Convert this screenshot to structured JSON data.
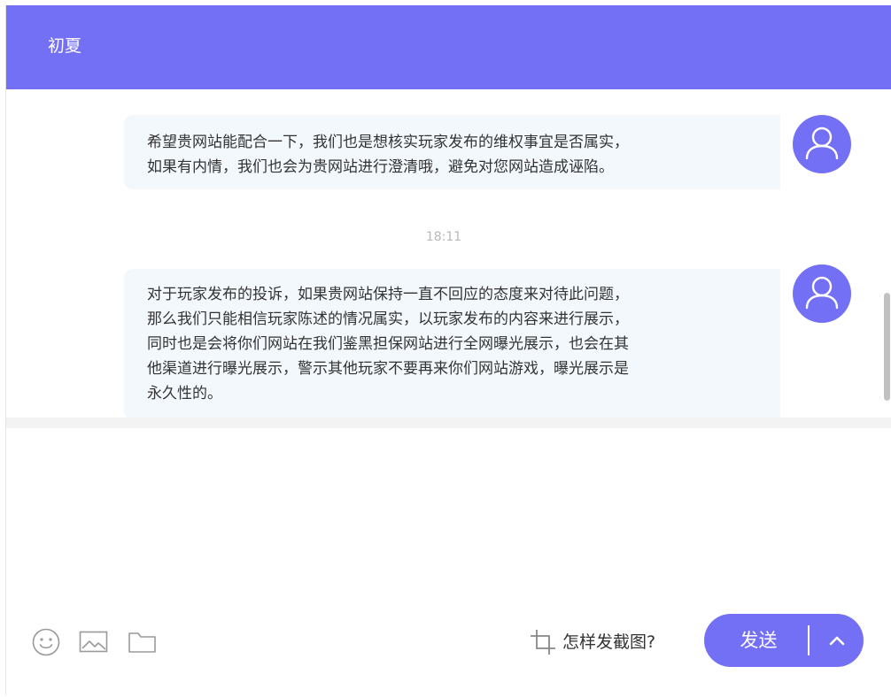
{
  "header": {
    "title": "初夏"
  },
  "messages": [
    {
      "lines": [
        "希望贵网站能配合一下，我们也是想核实玩家发布的维权事宜是否属实，",
        "如果有内情，我们也会为贵网站进行澄清哦，避免对您网站造成诬陷。"
      ],
      "avatar_icon": "user-icon"
    },
    {
      "timestamp": "18:11",
      "lines": [
        "对于玩家发布的投诉，如果贵网站保持一直不回应的态度来对待此问题，",
        "那么我们只能相信玩家陈述的情况属实，以玩家发布的内容来进行展示，",
        "同时也是会将你们网站在我们鉴黑担保网站进行全网曝光展示，也会在其",
        "他渠道进行曝光展示，警示其他玩家不要再来你们网站游戏，曝光展示是",
        "永久性的。"
      ],
      "avatar_icon": "user-icon"
    }
  ],
  "toolbar": {
    "icons": [
      "emoji-icon",
      "image-icon",
      "folder-icon"
    ],
    "screenshot_help": "怎样发截图?",
    "screenshot_icon": "crop-icon"
  },
  "send": {
    "label": "发送",
    "more_icon": "chevron-up-icon"
  },
  "colors": {
    "accent": "#7470f5",
    "bubble_bg": "#f3f8fd",
    "text": "#333333",
    "timestamp": "#b8b8b8"
  }
}
